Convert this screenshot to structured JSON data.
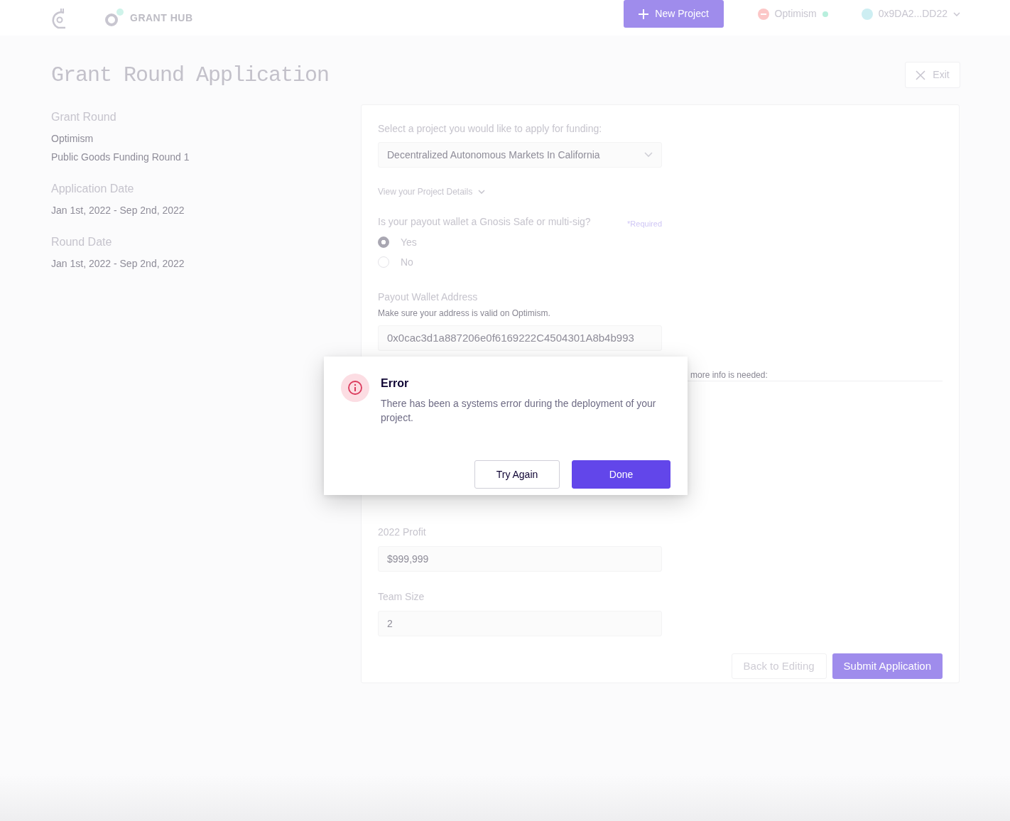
{
  "header": {
    "brand": "GRANT HUB",
    "new_project_button": "New Project",
    "network": "Optimism",
    "account": "0x9DA2...DD22"
  },
  "page_title": "Grant Round Application",
  "exit_button": "Exit",
  "sidebar": [
    {
      "heading": "Grant Round",
      "lines": [
        "Optimism",
        "Public Goods Funding Round 1"
      ]
    },
    {
      "heading": "Application Date",
      "lines": [
        "Jan 1st, 2022 - Sep 2nd, 2022"
      ]
    },
    {
      "heading": "Round Date",
      "lines": [
        "Jan 1st, 2022 - Sep 2nd, 2022"
      ]
    }
  ],
  "form": {
    "project_select": {
      "label": "Select a project you would like to apply for funding:",
      "value": "Decentralized Autonomous Markets In California"
    },
    "details_toggle": "View your Project Details",
    "payout_question": {
      "label": "Is your payout wallet a Gnosis Safe or multi-sig?",
      "required_note": "*Required",
      "options": [
        {
          "label": "Yes",
          "selected": true
        },
        {
          "label": "No",
          "selected": false
        }
      ]
    },
    "wallet": {
      "label": "Payout Wallet Address",
      "hint": "Make sure your address is valid on Optimism.",
      "value": "0x0cac3d1a887206e0f6169222C4504301A8b4b993"
    },
    "partial_prompt": "more info is needed:",
    "profit": {
      "label": "2022 Profit",
      "value": "$999,999"
    },
    "team_size": {
      "label": "Team Size",
      "value": "2"
    },
    "back_button": "Back to Editing",
    "submit_button": "Submit Application"
  },
  "dialog": {
    "title": "Error",
    "message": "There has been a systems error during the deployment of your project.",
    "buttons": [
      {
        "label": "Try Again",
        "kind": "secondary"
      },
      {
        "label": "Done",
        "kind": "primary"
      }
    ]
  }
}
